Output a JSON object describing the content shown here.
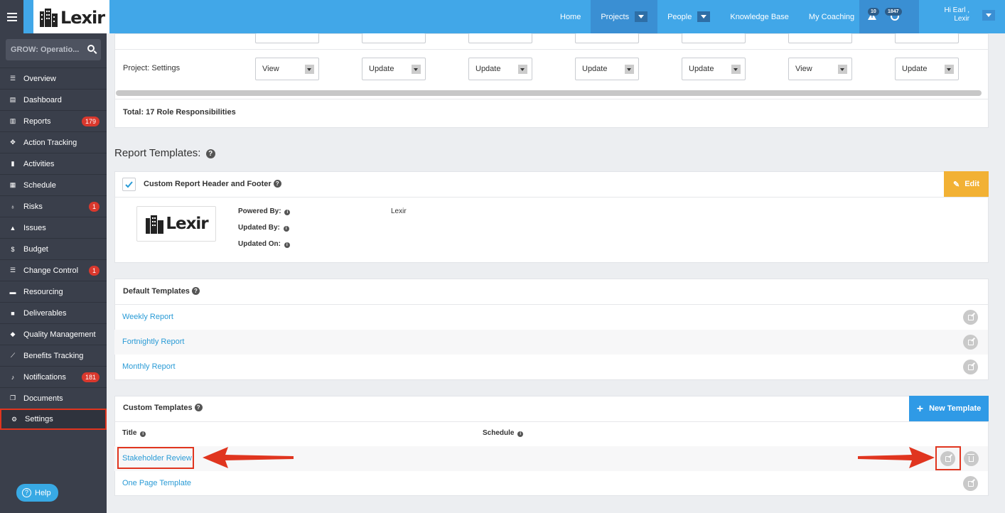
{
  "topbar": {
    "logo_text": "Lexir",
    "nav": [
      {
        "label": "Home"
      },
      {
        "label": "Projects"
      },
      {
        "label": "People"
      },
      {
        "label": "Knowledge Base"
      },
      {
        "label": "My Coaching"
      }
    ],
    "alert_count": "10",
    "message_count": "1847",
    "greeting": "Hi Earl ,",
    "org": "Lexir"
  },
  "sidebar": {
    "search_placeholder": "GROW: Operatio...",
    "items": [
      {
        "label": "Overview",
        "icon": "list-icon"
      },
      {
        "label": "Dashboard",
        "icon": "dashboard-icon"
      },
      {
        "label": "Reports",
        "icon": "bar-chart-icon",
        "count": "179"
      },
      {
        "label": "Action Tracking",
        "icon": "crosshair-icon"
      },
      {
        "label": "Activities",
        "icon": "bookmark-icon"
      },
      {
        "label": "Schedule",
        "icon": "calendar-icon"
      },
      {
        "label": "Risks",
        "icon": "lightbulb-icon",
        "count": "1"
      },
      {
        "label": "Issues",
        "icon": "warning-icon"
      },
      {
        "label": "Budget",
        "icon": "dollar-icon"
      },
      {
        "label": "Change Control",
        "icon": "list-icon",
        "count": "1"
      },
      {
        "label": "Resourcing",
        "icon": "folder-icon"
      },
      {
        "label": "Deliverables",
        "icon": "truck-icon"
      },
      {
        "label": "Quality Management",
        "icon": "tag-icon"
      },
      {
        "label": "Benefits Tracking",
        "icon": "line-chart-icon"
      },
      {
        "label": "Notifications",
        "icon": "bell-icon",
        "count": "181"
      },
      {
        "label": "Documents",
        "icon": "documents-icon"
      },
      {
        "label": "Settings",
        "icon": "cogs-icon"
      }
    ],
    "help_label": "Help"
  },
  "roles": {
    "row_label": "Project: Settings",
    "values": [
      "View",
      "Update",
      "Update",
      "Update",
      "Update",
      "View",
      "Update"
    ],
    "total": "Total: 17 Role Responsibilities"
  },
  "report_templates": {
    "title": "Report Templates:",
    "custom_header_label": "Custom Report Header and Footer",
    "edit_label": "Edit",
    "powered_by_label": "Powered By:",
    "powered_by_value": "Lexir",
    "updated_by_label": "Updated By:",
    "updated_on_label": "Updated On:"
  },
  "default_templates": {
    "title": "Default Templates",
    "items": [
      "Weekly Report",
      "Fortnightly Report",
      "Monthly Report"
    ]
  },
  "custom_templates": {
    "title": "Custom Templates",
    "new_label": "New Template",
    "col_title": "Title",
    "col_schedule": "Schedule",
    "items": [
      "Stakeholder Review",
      "One Page Template"
    ]
  },
  "colors": {
    "topbar": "#41a7e8",
    "sidebar": "#3a3f4b",
    "edit_button": "#f2b134",
    "new_template_button": "#2f9ae6",
    "highlight": "#e0351f"
  }
}
